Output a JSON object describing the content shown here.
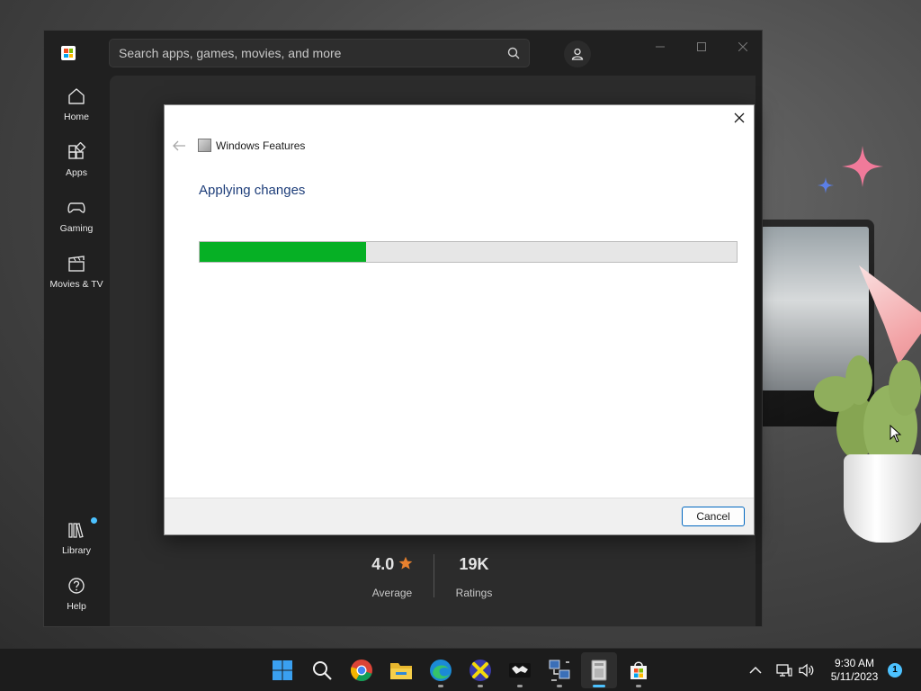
{
  "store": {
    "search_placeholder": "Search apps, games, movies, and more",
    "nav": [
      {
        "label": "Home",
        "icon": "home-icon"
      },
      {
        "label": "Apps",
        "icon": "apps-icon"
      },
      {
        "label": "Gaming",
        "icon": "gamepad-icon"
      },
      {
        "label": "Movies & TV",
        "icon": "clapperboard-icon"
      },
      {
        "label": "Library",
        "icon": "library-icon"
      },
      {
        "label": "Help",
        "icon": "help-icon"
      }
    ],
    "ratings": {
      "average_value": "4.0",
      "average_label": "Average",
      "count_value": "19K",
      "count_label": "Ratings"
    }
  },
  "dialog": {
    "title": "Windows Features",
    "heading": "Applying changes",
    "progress": 0.31,
    "cancel_label": "Cancel"
  },
  "taskbar": {
    "apps": [
      "start-icon",
      "search-icon",
      "chrome-icon",
      "file-explorer-icon",
      "edge-icon",
      "app-x-icon",
      "game-app-icon",
      "network-app-icon",
      "windows-features-icon",
      "store-icon"
    ],
    "time": "9:30 AM",
    "date": "5/11/2023",
    "notification_count": "1"
  },
  "colors": {
    "progress_fill": "#06b025",
    "accent": "#4cc2ff",
    "dialog_heading": "#1e3e7a"
  }
}
